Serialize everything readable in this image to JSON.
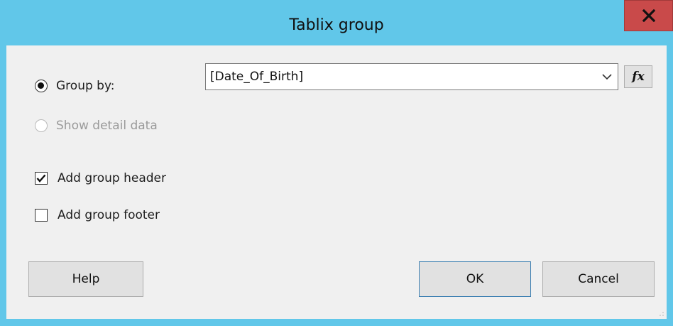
{
  "window": {
    "title": "Tablix group",
    "close_label": "X"
  },
  "options": {
    "group_by_label": "Group by:",
    "group_by_selected": true,
    "show_detail_label": "Show detail data",
    "show_detail_enabled": false
  },
  "group_by_combo": {
    "value": "[Date_Of_Birth]"
  },
  "expression_button": {
    "label": "fx"
  },
  "checkboxes": {
    "add_header_label": "Add group header",
    "add_header_checked": true,
    "add_footer_label": "Add group footer",
    "add_footer_checked": false
  },
  "buttons": {
    "help_label": "Help",
    "ok_label": "OK",
    "cancel_label": "Cancel"
  },
  "colors": {
    "titlebar": "#61c7e9",
    "close": "#c94a4a",
    "client": "#f0f0f0",
    "default_button_border": "#3c7fb1"
  }
}
